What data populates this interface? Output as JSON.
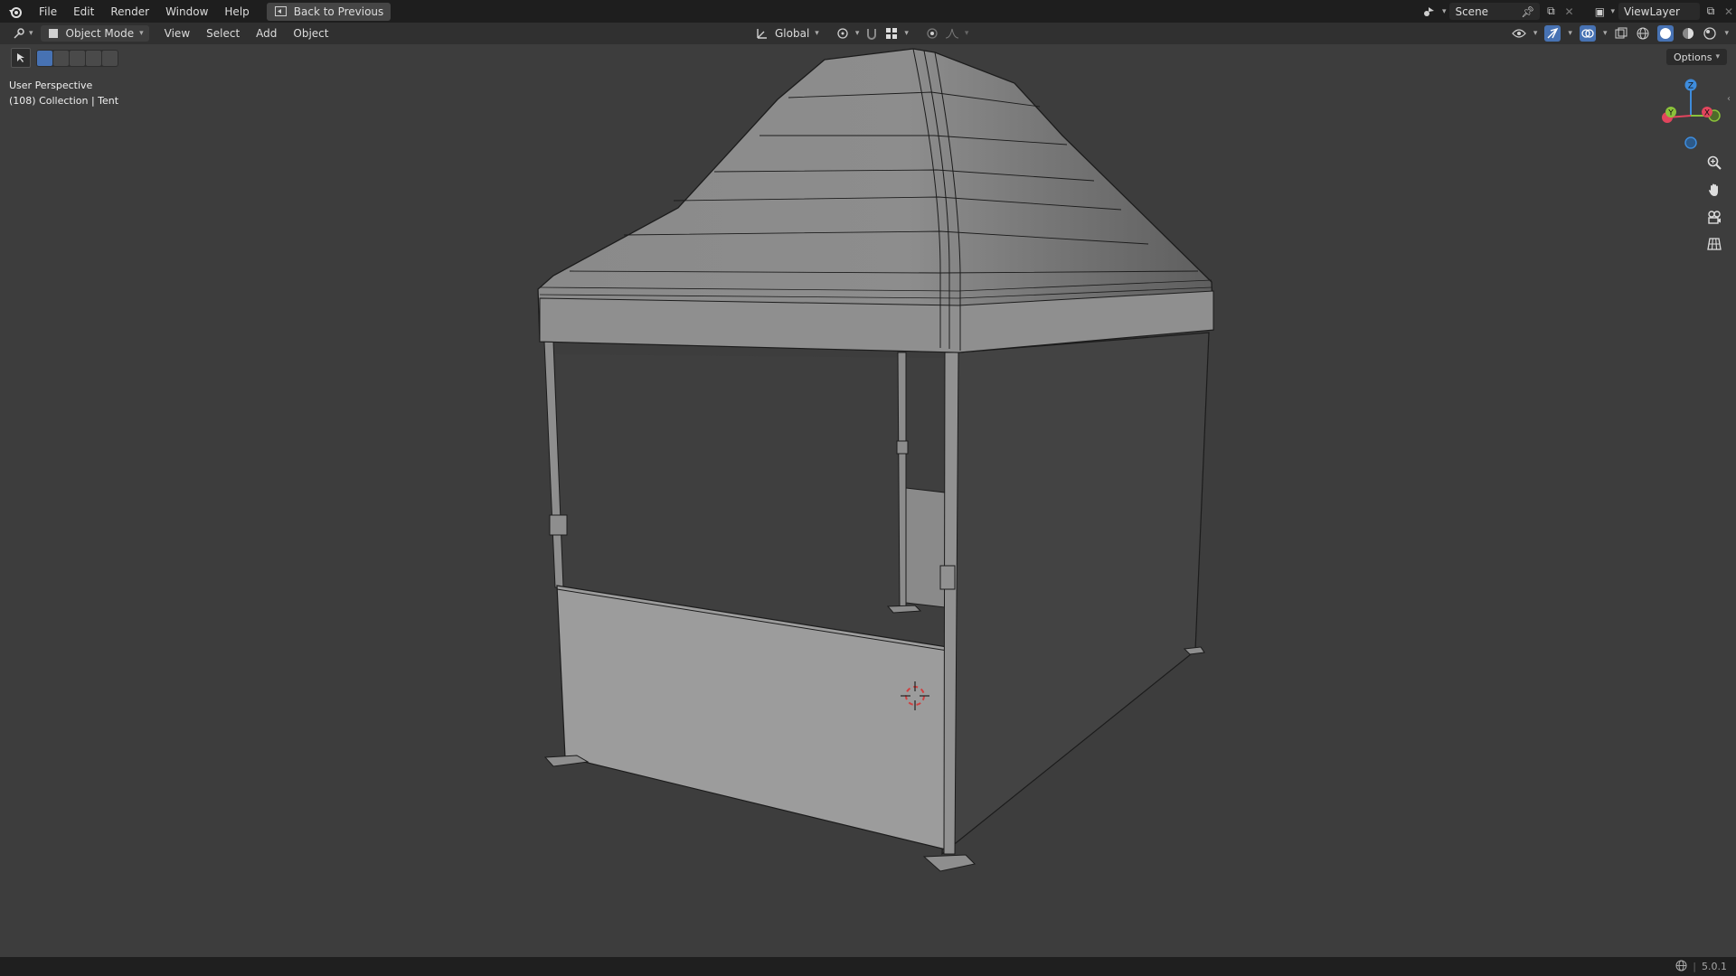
{
  "menubar": {
    "items": [
      "File",
      "Edit",
      "Render",
      "Window",
      "Help"
    ],
    "back_button": "Back to Previous",
    "scene": "Scene",
    "view_layer": "ViewLayer"
  },
  "view_header": {
    "mode": "Object Mode",
    "menus": [
      "View",
      "Select",
      "Add",
      "Object"
    ],
    "transform_orientation": "Global"
  },
  "options_label": "Options",
  "viewport": {
    "perspective": "User Perspective",
    "collection_line": "(108) Collection | Tent"
  },
  "gizmo": {
    "x_label": "X",
    "y_label": "Y",
    "z_label": "Z"
  },
  "status": {
    "version": "5.0.1"
  },
  "colors": {
    "accent": "#4772b3",
    "axis_x": "#e2455d",
    "axis_y": "#8bc23a",
    "axis_z": "#3e8cdc",
    "cursor": "#d04040"
  }
}
